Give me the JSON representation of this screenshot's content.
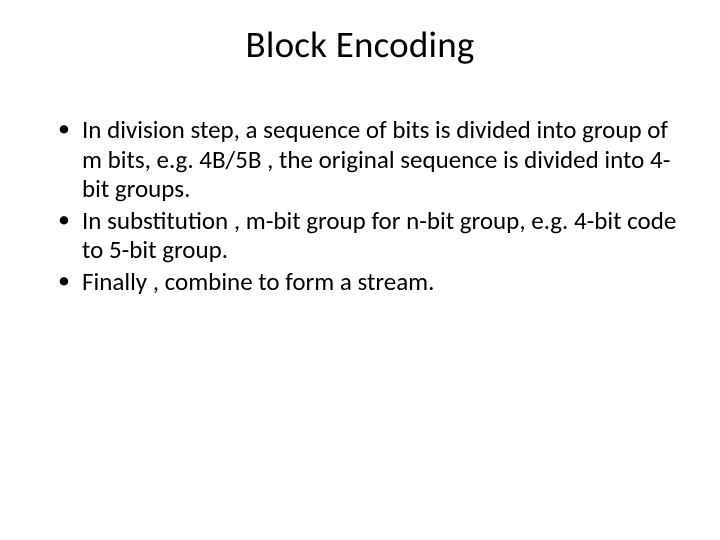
{
  "slide": {
    "title": "Block Encoding",
    "bullets": [
      "In division step, a sequence of bits is divided into group of m bits, e.g. 4B/5B , the original sequence is divided into 4-bit groups.",
      "In substitution , m-bit group for n-bit group, e.g. 4-bit code to 5-bit group.",
      "Finally , combine to form a stream."
    ]
  }
}
